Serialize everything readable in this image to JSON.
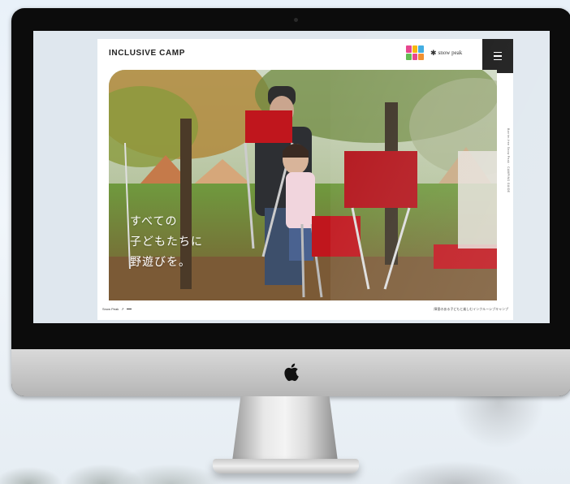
{
  "website": {
    "logo_text": "INCLUSIVE CAMP",
    "partner_logo_b_text": "snow peak",
    "hero_lines": [
      "すべての",
      "子どもたちに",
      "野遊びを。"
    ],
    "vertical_caption": "Barrier-free Snow Peak · CAMPING GUIDE",
    "footer_left_label": "Snow Peak",
    "footer_left_arrow": "↗",
    "footer_right_text": "障害のある子どもと楽しむインクルーシブキャンプ"
  },
  "partner_logo_a_colors": [
    "#e63d8a",
    "#f5b400",
    "#39a9e0",
    "#5bb84a",
    "#e63d8a",
    "#f08a24"
  ],
  "colors": {
    "bezel": "#0c0c0c",
    "chin": "#c4c4c4",
    "menu_button": "#111111",
    "hero_chair_red": "#c0161d"
  }
}
